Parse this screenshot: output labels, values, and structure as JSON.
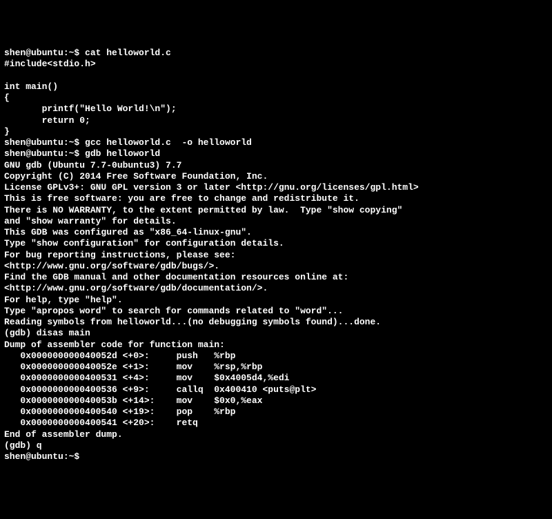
{
  "lines": [
    "shen@ubuntu:~$ cat helloworld.c",
    "#include<stdio.h>",
    "",
    "int main()",
    "{",
    "       printf(\"Hello World!\\n\");",
    "       return 0;",
    "}",
    "shen@ubuntu:~$ gcc helloworld.c  -o helloworld",
    "shen@ubuntu:~$ gdb helloworld",
    "GNU gdb (Ubuntu 7.7-0ubuntu3) 7.7",
    "Copyright (C) 2014 Free Software Foundation, Inc.",
    "License GPLv3+: GNU GPL version 3 or later <http://gnu.org/licenses/gpl.html>",
    "This is free software: you are free to change and redistribute it.",
    "There is NO WARRANTY, to the extent permitted by law.  Type \"show copying\"",
    "and \"show warranty\" for details.",
    "This GDB was configured as \"x86_64-linux-gnu\".",
    "Type \"show configuration\" for configuration details.",
    "For bug reporting instructions, please see:",
    "<http://www.gnu.org/software/gdb/bugs/>.",
    "Find the GDB manual and other documentation resources online at:",
    "<http://www.gnu.org/software/gdb/documentation/>.",
    "For help, type \"help\".",
    "Type \"apropos word\" to search for commands related to \"word\"...",
    "Reading symbols from helloworld...(no debugging symbols found)...done.",
    "(gdb) disas main",
    "Dump of assembler code for function main:",
    "   0x000000000040052d <+0>:     push   %rbp",
    "   0x000000000040052e <+1>:     mov    %rsp,%rbp",
    "   0x0000000000400531 <+4>:     mov    $0x4005d4,%edi",
    "   0x0000000000400536 <+9>:     callq  0x400410 <puts@plt>",
    "   0x000000000040053b <+14>:    mov    $0x0,%eax",
    "   0x0000000000400540 <+19>:    pop    %rbp",
    "   0x0000000000400541 <+20>:    retq",
    "End of assembler dump.",
    "(gdb) q",
    "shen@ubuntu:~$"
  ]
}
